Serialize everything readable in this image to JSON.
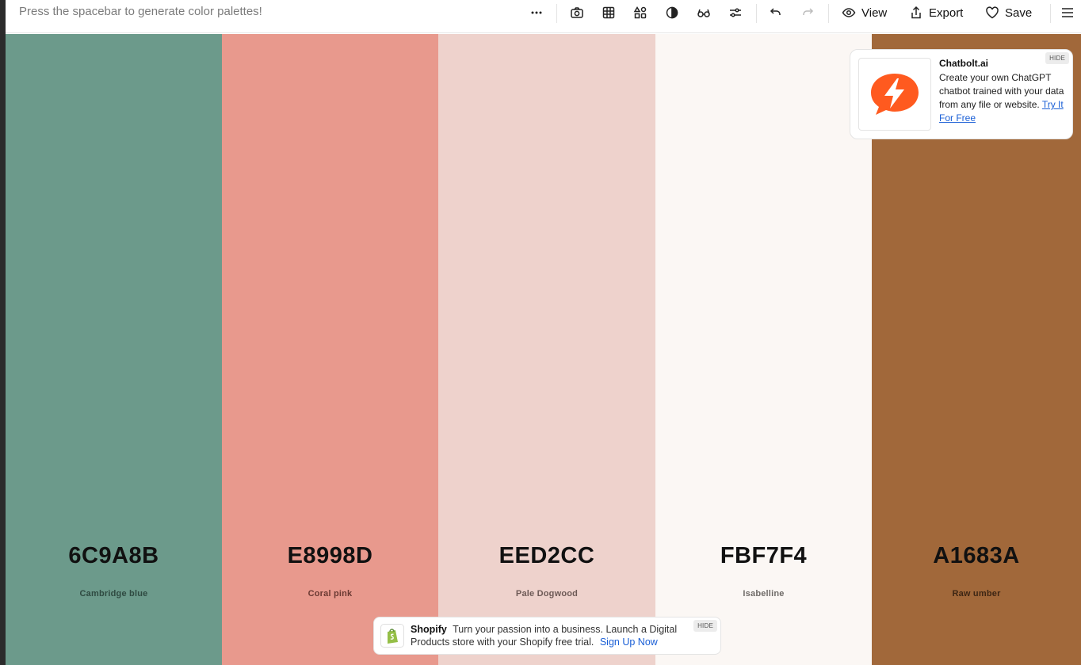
{
  "toolbar": {
    "hint": "Press the spacebar to generate color palettes!",
    "view_label": "View",
    "export_label": "Export",
    "save_label": "Save"
  },
  "palette": [
    {
      "hex": "6C9A8B",
      "name": "Cambridge blue",
      "color": "#6C9A8B",
      "text_color": "#111111",
      "name_color": "#2f4a41"
    },
    {
      "hex": "E8998D",
      "name": "Coral pink",
      "color": "#E8998D",
      "text_color": "#111111",
      "name_color": "#6b3a33"
    },
    {
      "hex": "EED2CC",
      "name": "Pale Dogwood",
      "color": "#EED2CC",
      "text_color": "#111111",
      "name_color": "#6e5b57"
    },
    {
      "hex": "FBF7F4",
      "name": "Isabelline",
      "color": "#FBF7F4",
      "text_color": "#111111",
      "name_color": "#6f6b68"
    },
    {
      "hex": "A1683A",
      "name": "Raw umber",
      "color": "#A1683A",
      "text_color": "#111111",
      "name_color": "#3e2614"
    }
  ],
  "ad_top": {
    "title": "Chatbolt.ai",
    "text": "Create your own ChatGPT chatbot trained with your data from any file or website.",
    "link": "Try It For Free",
    "hide": "HIDE",
    "logo_color": "#FF5A1F"
  },
  "ad_bottom": {
    "brand": "Shopify",
    "text": "Turn your passion into a business. Launch a Digital Products store with your Shopify free trial.",
    "link": "Sign Up Now",
    "hide": "HIDE",
    "icon_color": "#95BF47"
  }
}
